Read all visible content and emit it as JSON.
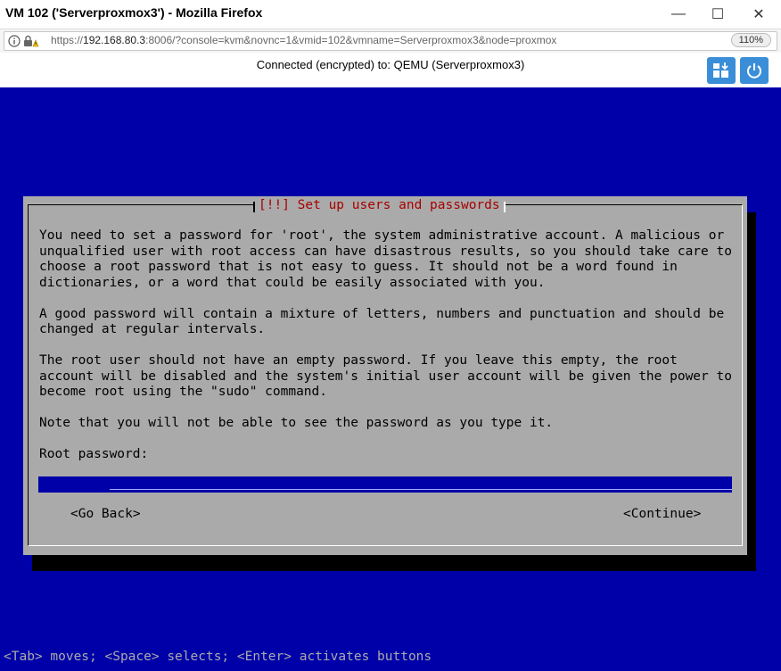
{
  "window": {
    "title": "VM 102 ('Serverproxmox3') - Mozilla Firefox",
    "minimize": "—",
    "maximize": "☐",
    "close": "✕"
  },
  "urlbar": {
    "scheme": "https://",
    "host": "192.168.80.3",
    "rest": ":8006/?console=kvm&novnc=1&vmid=102&vmname=Serverproxmox3&node=proxmox",
    "zoom": "110%"
  },
  "novnc": {
    "status": "Connected (encrypted) to: QEMU (Serverproxmox3)"
  },
  "installer": {
    "title": "[!!] Set up users and passwords",
    "lines": [
      "You need to set a password for 'root', the system administrative account. A malicious or",
      "unqualified user with root access can have disastrous results, so you should take care to",
      "choose a root password that is not easy to guess. It should not be a word found in",
      "dictionaries, or a word that could be easily associated with you.",
      "",
      "A good password will contain a mixture of letters, numbers and punctuation and should be",
      "changed at regular intervals.",
      "",
      "The root user should not have an empty password. If you leave this empty, the root",
      "account will be disabled and the system's initial user account will be given the power to",
      "become root using the \"sudo\" command.",
      "",
      "Note that you will not be able to see the password as you type it.",
      "",
      "Root password:"
    ],
    "password_value": "********",
    "go_back": "<Go Back>",
    "continue": "<Continue>"
  },
  "footer": {
    "hint": "<Tab> moves; <Space> selects; <Enter> activates buttons"
  },
  "colors": {
    "console_bg": "#0000a8",
    "dialog_bg": "#aaaaaa",
    "title_red": "#a80000",
    "novnc_button": "#3a8ed8"
  }
}
